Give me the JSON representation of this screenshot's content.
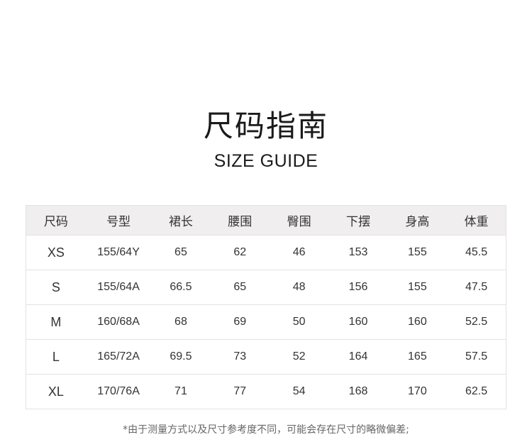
{
  "title_cn": "尺码指南",
  "title_en": "SIZE GUIDE",
  "table": {
    "headers": [
      "尺码",
      "号型",
      "裙长",
      "腰围",
      "臀围",
      "下摆",
      "身高",
      "体重"
    ],
    "rows": [
      [
        "XS",
        "155/64Y",
        "65",
        "62",
        "46",
        "153",
        "155",
        "45.5"
      ],
      [
        "S",
        "155/64A",
        "66.5",
        "65",
        "48",
        "156",
        "155",
        "47.5"
      ],
      [
        "M",
        "160/68A",
        "68",
        "69",
        "50",
        "160",
        "160",
        "52.5"
      ],
      [
        "L",
        "165/72A",
        "69.5",
        "73",
        "52",
        "164",
        "165",
        "57.5"
      ],
      [
        "XL",
        "170/76A",
        "71",
        "77",
        "54",
        "168",
        "170",
        "62.5"
      ]
    ]
  },
  "footnote": "*由于测量方式以及尺寸参考度不同，可能会存在尺寸的略微偏差;",
  "colors": {
    "header_bg": "#f0eeee",
    "border": "#e2e2e2",
    "text": "#333333"
  }
}
